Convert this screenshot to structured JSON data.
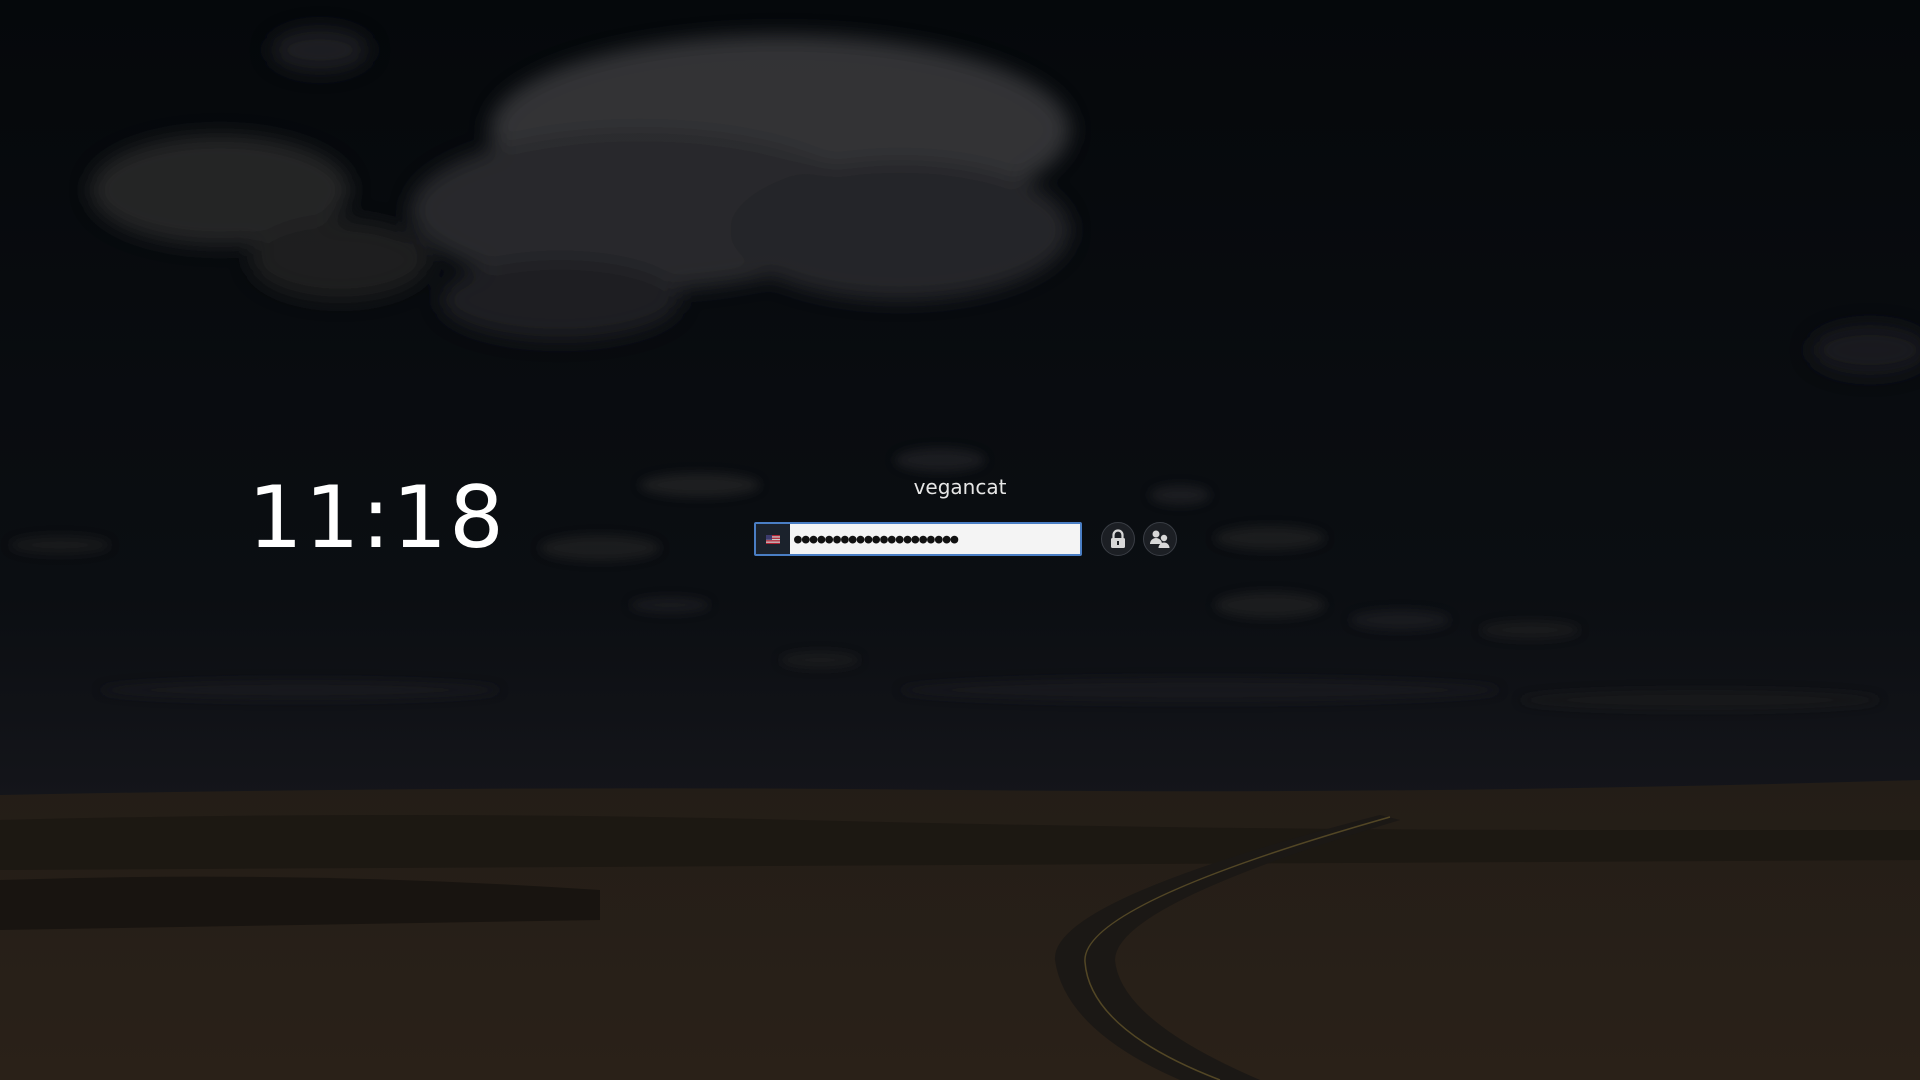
{
  "clock": {
    "time": "11:18"
  },
  "user": {
    "name": "vegancat"
  },
  "password": {
    "masked_value": "●●●●●●●●●●●●●●●●●●●●●",
    "keyboard_layout_icon": "us-flag-icon"
  },
  "buttons": {
    "unlock_icon": "lock-icon",
    "switch_user_icon": "users-icon"
  },
  "colors": {
    "background": "#06090d",
    "input_border": "#4a7ec4",
    "text": "#ffffff"
  }
}
